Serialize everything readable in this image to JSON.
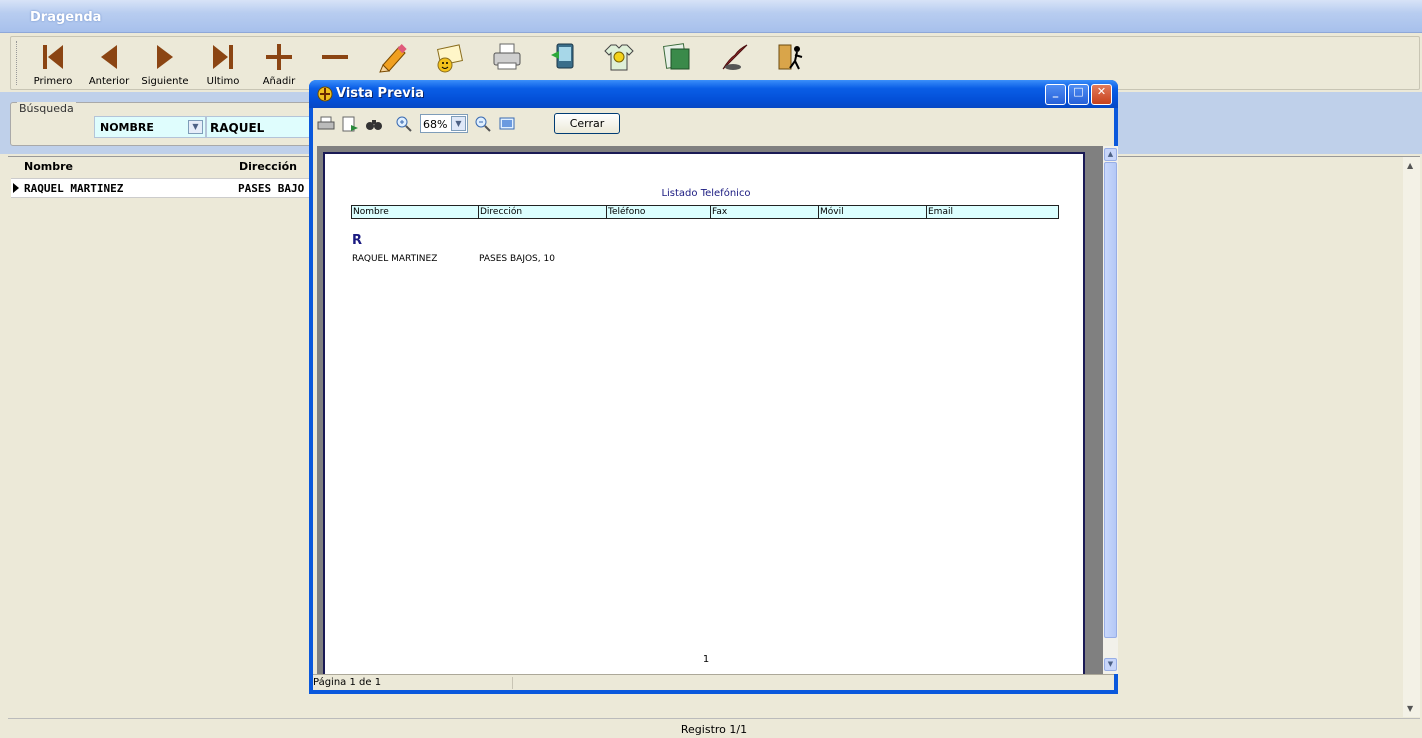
{
  "app": {
    "title": "Dragenda"
  },
  "toolbar": {
    "buttons": [
      {
        "label": "Primero",
        "icon": "first-record-icon"
      },
      {
        "label": "Anterior",
        "icon": "previous-record-icon"
      },
      {
        "label": "Siguiente",
        "icon": "next-record-icon"
      },
      {
        "label": "Ultimo",
        "icon": "last-record-icon"
      },
      {
        "label": "Añadir",
        "icon": "add-icon"
      },
      {
        "label": "",
        "icon": "delete-icon"
      },
      {
        "label": "",
        "icon": "edit-pencil-icon"
      },
      {
        "label": "",
        "icon": "email-icon"
      },
      {
        "label": "",
        "icon": "printer-icon"
      },
      {
        "label": "",
        "icon": "pda-sync-icon"
      },
      {
        "label": "",
        "icon": "tshirt-icon"
      },
      {
        "label": "",
        "icon": "report-icon"
      },
      {
        "label": "",
        "icon": "quill-icon"
      },
      {
        "label": "",
        "icon": "exit-door-icon"
      }
    ]
  },
  "search": {
    "legend": "Búsqueda",
    "field": "NOMBRE",
    "value": "RAQUEL"
  },
  "grid": {
    "columns": [
      "Nombre",
      "Dirección"
    ],
    "rows": [
      {
        "nombre": "RAQUEL MARTINEZ",
        "direccion": "PASES BAJO"
      }
    ]
  },
  "status": {
    "record": "Registro 1/1"
  },
  "preview": {
    "title": "Vista Previa",
    "zoom": "68%",
    "close_label": "Cerrar",
    "status_text": "Página 1 de 1",
    "report": {
      "title": "Listado Telefónico",
      "columns": [
        "Nombre",
        "Dirección",
        "Teléfono",
        "Fax",
        "Móvil",
        "Email"
      ],
      "group_letter": "R",
      "rows": [
        {
          "nombre": "RAQUEL MARTINEZ",
          "direccion": "PASES BAJOS, 10"
        }
      ],
      "page_number": "1"
    }
  },
  "colors": {
    "accent_blue": "#0a58dc",
    "toolbar_icon_brown": "#8b4513",
    "search_field_bg": "#dffdfd",
    "report_header_bg": "#dcffff"
  }
}
